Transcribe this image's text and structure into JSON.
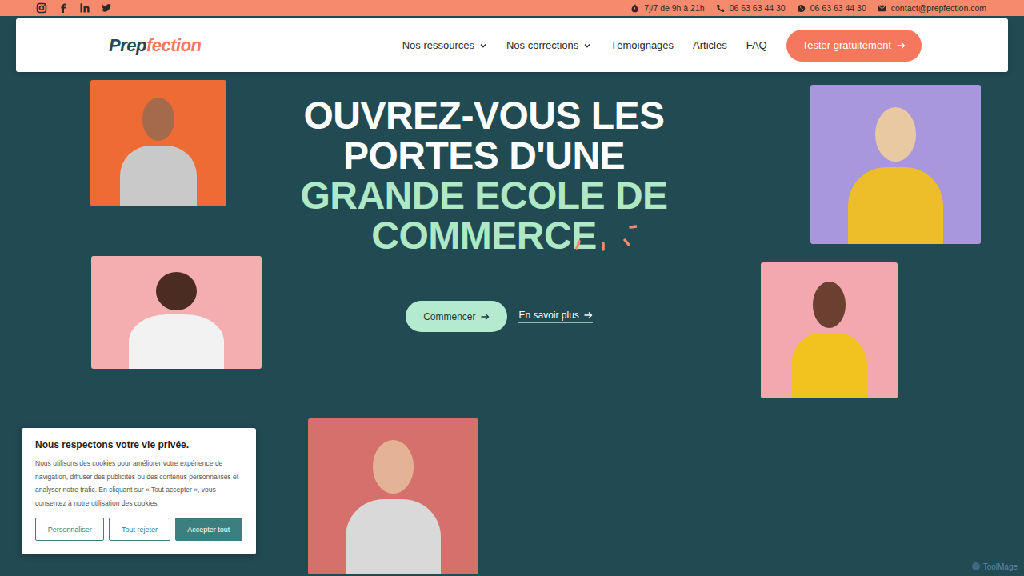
{
  "topbar": {
    "contacts": [
      {
        "text": "7j/7 de 9h à 21h",
        "kind": "hours"
      },
      {
        "text": "06 63 63 44 30",
        "kind": "phone"
      },
      {
        "text": "06 63 63 44 30",
        "kind": "whatsapp"
      },
      {
        "text": "contact@prepfection.com",
        "kind": "email"
      }
    ]
  },
  "nav": {
    "logo": {
      "first": "Prep",
      "second": "fection"
    },
    "items": [
      {
        "label": "Nos ressources",
        "dropdown": true
      },
      {
        "label": "Nos corrections",
        "dropdown": true
      },
      {
        "label": "Témoignages",
        "dropdown": false
      },
      {
        "label": "Articles",
        "dropdown": false
      },
      {
        "label": "FAQ",
        "dropdown": false
      }
    ],
    "cta": "Tester gratuitement"
  },
  "hero": {
    "title_white": [
      "OUVREZ-VOUS LES",
      "PORTES D'UNE"
    ],
    "title_accent": [
      "GRANDE ECOLE DE",
      "COMMERCE"
    ],
    "primary": "Commencer",
    "secondary": "En savoir plus"
  },
  "cookie": {
    "title": "Nous respectons votre vie privée.",
    "text": "Nous utilisons des cookies pour améliorer votre expérience de navigation, diffuser des publicités ou des contenus personnalisés et analyser notre trafic. En cliquant sur « Tout accepter », vous consentez à notre utilisation des cookies.",
    "buttons": [
      {
        "label": "Personnaliser",
        "kind": "outline"
      },
      {
        "label": "Tout rejeter",
        "kind": "outline"
      },
      {
        "label": "Accepter tout",
        "kind": "filled"
      }
    ]
  },
  "watermark": "ToolMage"
}
